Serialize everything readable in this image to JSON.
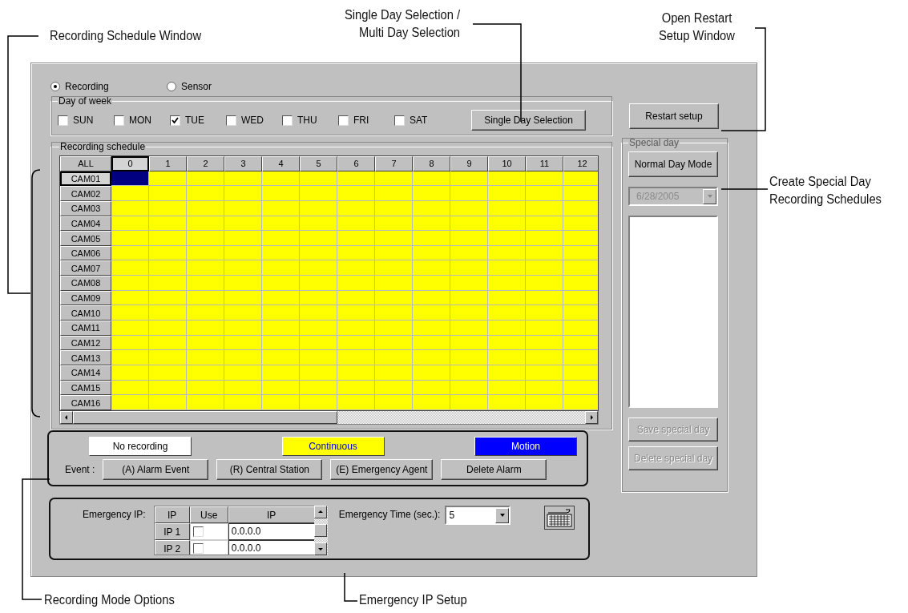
{
  "callouts": [
    {
      "text": "Recording Schedule Window"
    },
    {
      "text": "Single Day Selection /\nMulti Day Selection"
    },
    {
      "text": "Open Restart\nSetup Window"
    },
    {
      "text": "Create Special Day\nRecording Schedules"
    },
    {
      "text": "Recording Mode Options"
    },
    {
      "text": "Emergency IP Setup"
    }
  ],
  "mode_radios": [
    {
      "label": "Recording",
      "selected": true
    },
    {
      "label": "Sensor",
      "selected": false
    }
  ],
  "day_of_week": {
    "title": "Day of week",
    "days": [
      {
        "label": "SUN",
        "checked": false
      },
      {
        "label": "MON",
        "checked": false
      },
      {
        "label": "TUE",
        "checked": true
      },
      {
        "label": "WED",
        "checked": false
      },
      {
        "label": "THU",
        "checked": false
      },
      {
        "label": "FRI",
        "checked": false
      },
      {
        "label": "SAT",
        "checked": false
      }
    ],
    "selection_button": "Single Day Selection"
  },
  "restart_button": "Restart setup",
  "schedule": {
    "title": "Recording schedule",
    "corner": "ALL",
    "hours": [
      {
        "label": "0",
        "selected": true
      },
      {
        "label": "1",
        "selected": false
      },
      {
        "label": "2",
        "selected": false
      },
      {
        "label": "3",
        "selected": false
      },
      {
        "label": "4",
        "selected": false
      },
      {
        "label": "5",
        "selected": false
      },
      {
        "label": "6",
        "selected": false
      },
      {
        "label": "7",
        "selected": false
      },
      {
        "label": "8",
        "selected": false
      },
      {
        "label": "9",
        "selected": false
      },
      {
        "label": "10",
        "selected": false
      },
      {
        "label": "11",
        "selected": false
      },
      {
        "label": "12",
        "selected": false
      }
    ],
    "rows": [
      {
        "label": "CAM01",
        "selected": true,
        "color": "#ffff00"
      },
      {
        "label": "CAM02",
        "selected": false,
        "color": "#ffff00"
      },
      {
        "label": "CAM03",
        "selected": false,
        "color": "#ffff00"
      },
      {
        "label": "CAM04",
        "selected": false,
        "color": "#ffff00"
      },
      {
        "label": "CAM05",
        "selected": false,
        "color": "#ffff00"
      },
      {
        "label": "CAM06",
        "selected": false,
        "color": "#ffff00"
      },
      {
        "label": "CAM07",
        "selected": false,
        "color": "#ffff00"
      },
      {
        "label": "CAM08",
        "selected": false,
        "color": "#ffff00"
      },
      {
        "label": "CAM09",
        "selected": false,
        "color": "#ffff00"
      },
      {
        "label": "CAM10",
        "selected": false,
        "color": "#ffff00"
      },
      {
        "label": "CAM11",
        "selected": false,
        "color": "#ffff00"
      },
      {
        "label": "CAM12",
        "selected": false,
        "color": "#ffff00"
      },
      {
        "label": "CAM13",
        "selected": false,
        "color": "#ffff00"
      },
      {
        "label": "CAM14",
        "selected": false,
        "color": "#ffff00"
      },
      {
        "label": "CAM15",
        "selected": false,
        "color": "#ffff00"
      },
      {
        "label": "CAM16",
        "selected": false,
        "color": "#ffff00"
      }
    ]
  },
  "special_day": {
    "title": "Special day",
    "mode_button": "Normal Day Mode",
    "date": "6/28/2005",
    "date_disabled": true,
    "buttons": [
      {
        "label": "Save special day",
        "disabled": true
      },
      {
        "label": "Delete special day",
        "disabled": true
      }
    ]
  },
  "legend": [
    {
      "kind": "none",
      "label": "No recording"
    },
    {
      "kind": "continuous",
      "label": "Continuous"
    },
    {
      "kind": "motion",
      "label": "Motion"
    }
  ],
  "event": {
    "label": "Event :",
    "buttons": [
      "(A) Alarm Event",
      "(R) Central Station",
      "(E) Emergency Agent",
      "Delete Alarm"
    ]
  },
  "emergency": {
    "label": "Emergency IP:",
    "columns": [
      "IP",
      "Use",
      "IP"
    ],
    "rows": [
      {
        "name": "IP 1",
        "checked": false,
        "ip": "0.0.0.0"
      },
      {
        "name": "IP 2",
        "checked": false,
        "ip": "0.0.0.0"
      }
    ],
    "time_label": "Emergency Time (sec.):",
    "time_value": "5"
  }
}
